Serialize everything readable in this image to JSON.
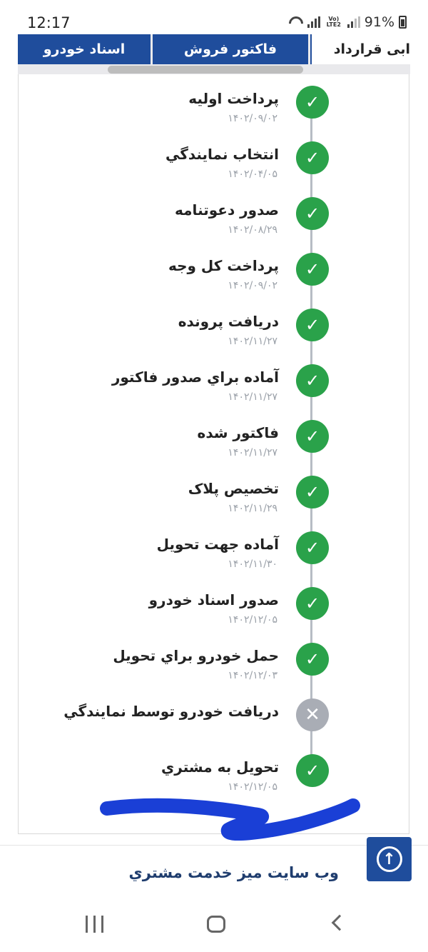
{
  "status": {
    "time": "12:17",
    "network": "Vo) LTE2",
    "battery": "91%"
  },
  "tabs": [
    {
      "label": "اسناد خودرو"
    },
    {
      "label": "فاکتور فروش"
    },
    {
      "label": "ابی قرارداد"
    }
  ],
  "steps": [
    {
      "title": "پرداخت اوليه",
      "date": "۱۴۰۲/۰۹/۰۲",
      "status": "done"
    },
    {
      "title": "انتخاب نمايندگي",
      "date": "۱۴۰۲/۰۴/۰۵",
      "status": "done"
    },
    {
      "title": "صدور دعوتنامه",
      "date": "۱۴۰۲/۰۸/۲۹",
      "status": "done"
    },
    {
      "title": "پرداخت کل وجه",
      "date": "۱۴۰۲/۰۹/۰۲",
      "status": "done"
    },
    {
      "title": "دريافت پرونده",
      "date": "۱۴۰۲/۱۱/۲۷",
      "status": "done"
    },
    {
      "title": "آماده براي صدور فاکتور",
      "date": "۱۴۰۲/۱۱/۲۷",
      "status": "done"
    },
    {
      "title": "فاکتور شده",
      "date": "۱۴۰۲/۱۱/۲۷",
      "status": "done"
    },
    {
      "title": "تخصيص پلاک",
      "date": "۱۴۰۲/۱۱/۲۹",
      "status": "done"
    },
    {
      "title": "آماده جهت تحويل",
      "date": "۱۴۰۲/۱۱/۳۰",
      "status": "done"
    },
    {
      "title": "صدور اسناد خودرو",
      "date": "۱۴۰۲/۱۲/۰۵",
      "status": "done"
    },
    {
      "title": "حمل خودرو براي تحويل",
      "date": "۱۴۰۲/۱۲/۰۳",
      "status": "done"
    },
    {
      "title": "دريافت خودرو توسط نمايندگي",
      "date": "",
      "status": "pending"
    },
    {
      "title": "تحويل به مشتري",
      "date": "۱۴۰۲/۱۲/۰۵",
      "status": "done"
    }
  ],
  "footer": {
    "link_label": "وب سايت ميز خدمت مشتري"
  },
  "colors": {
    "primary": "#1f4d9c",
    "success": "#2aa24a",
    "pending": "#a9adb5",
    "scribble": "#1a3fd6"
  },
  "icons": {
    "done": "check-icon",
    "pending": "x-icon",
    "up": "arrow-up-circle-icon"
  }
}
